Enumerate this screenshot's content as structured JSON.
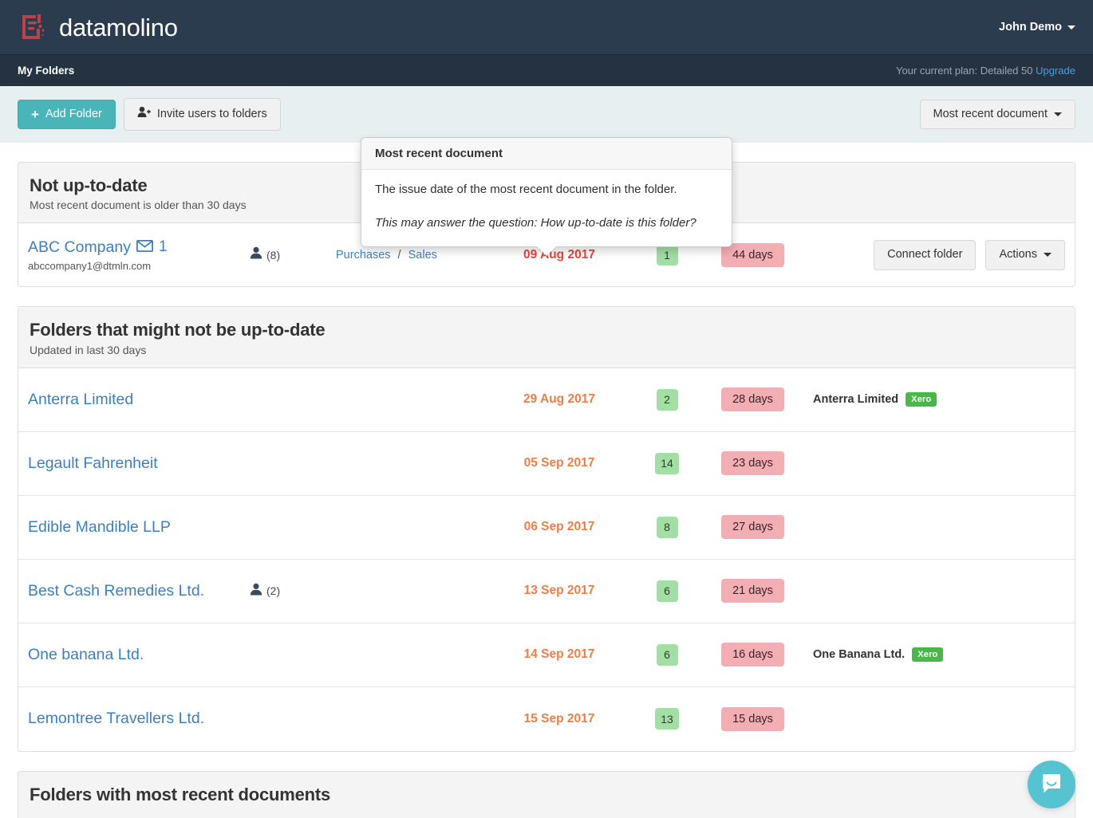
{
  "navbar": {
    "brand_name": "datamolino",
    "logo_icon": "datamolino-document-icon",
    "user_name": "John Demo"
  },
  "subnav": {
    "title": "My Folders",
    "plan_text": "Your current plan: Detailed 50",
    "upgrade_label": "Upgrade"
  },
  "toolbar": {
    "add_folder_label": "Add Folder",
    "add_folder_plus": "+",
    "invite_users_label": "Invite users to folders",
    "sort_label": "Most recent document"
  },
  "popover": {
    "title": "Most recent document",
    "body": "The issue date of the most recent document in the folder.",
    "note": "This may answer the question: How up-to-date is this folder?"
  },
  "sections": [
    {
      "title": "Not up-to-date",
      "subtitle": "Most recent document is older than 30 days",
      "rows": [
        {
          "name": "ABC Company",
          "mail_count": "1",
          "email": "abccompany1@dtmln.com",
          "users": "(8)",
          "type_purchases": "Purchases",
          "type_separator": "/",
          "type_sales": "Sales",
          "date": "09 Aug 2017",
          "doc_count": "1",
          "days": "44 days",
          "connect_label": "Connect folder",
          "actions_label": "Actions"
        }
      ]
    },
    {
      "title": "Folders that might not be up-to-date",
      "subtitle": "Updated in last 30 days",
      "rows": [
        {
          "name": "Anterra Limited",
          "users": "",
          "date": "29 Aug 2017",
          "doc_count": "2",
          "days": "28 days",
          "connection": "Anterra Limited",
          "connection_badge": "Xero"
        },
        {
          "name": "Legault Fahrenheit",
          "users": "",
          "date": "05 Sep 2017",
          "doc_count": "14",
          "days": "23 days",
          "connection": "",
          "connection_badge": ""
        },
        {
          "name": "Edible Mandible LLP",
          "users": "",
          "date": "06 Sep 2017",
          "doc_count": "8",
          "days": "27 days",
          "connection": "",
          "connection_badge": ""
        },
        {
          "name": "Best Cash Remedies Ltd.",
          "users": "(2)",
          "date": "13 Sep 2017",
          "doc_count": "6",
          "days": "21 days",
          "connection": "",
          "connection_badge": ""
        },
        {
          "name": "One banana Ltd.",
          "users": "",
          "date": "14 Sep 2017",
          "doc_count": "6",
          "days": "16 days",
          "connection": "One Banana Ltd.",
          "connection_badge": "Xero"
        },
        {
          "name": "Lemontree Travellers Ltd.",
          "users": "",
          "date": "15 Sep 2017",
          "doc_count": "13",
          "days": "15 days",
          "connection": "",
          "connection_badge": ""
        }
      ]
    },
    {
      "title": "Folders with most recent documents",
      "subtitle": "",
      "rows": []
    }
  ],
  "launcher": {
    "icon": "chat-bubble-icon"
  },
  "colors": {
    "navbar_bg": "#2b3c4e",
    "subnav_bg": "#243241",
    "toolbar_bg": "#e7eff1",
    "primary": "#4ab5b8",
    "link": "#3a7fc3",
    "date_red": "#e8453c",
    "date_orange": "#ef7d45",
    "badge_green": "#a2dfa4",
    "badge_pink": "#f3aeb4",
    "xero_green": "#49b749",
    "launcher": "#55c3d0"
  }
}
